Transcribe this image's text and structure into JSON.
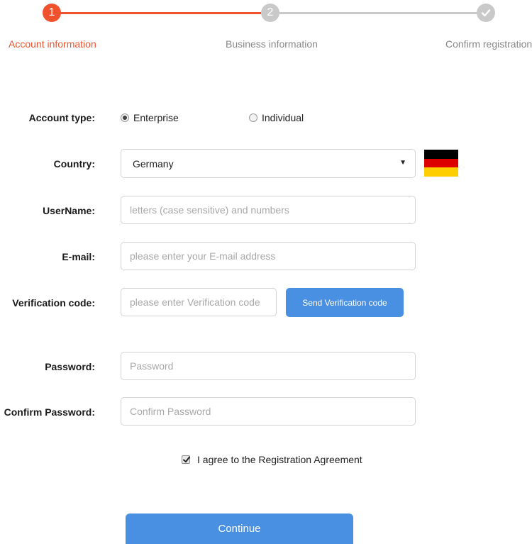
{
  "colors": {
    "active": "#f0522e",
    "inactive": "#c9c9c9",
    "primary": "#4a90e2"
  },
  "stepper": {
    "steps": [
      {
        "number": "1",
        "label": "Account information",
        "state": "active"
      },
      {
        "number": "2",
        "label": "Business information",
        "state": "inactive"
      },
      {
        "number": "",
        "label": "Confirm registration",
        "state": "inactive",
        "icon": "checkmark-icon"
      }
    ]
  },
  "form": {
    "account_type": {
      "label": "Account type:",
      "options": [
        {
          "label": "Enterprise",
          "selected": true
        },
        {
          "label": "Individual",
          "selected": false
        }
      ]
    },
    "country": {
      "label": "Country:",
      "value": "Germany",
      "flag_colors": [
        "#000000",
        "#dd0000",
        "#ffce00"
      ]
    },
    "username": {
      "label": "UserName:",
      "placeholder": "letters (case sensitive) and numbers"
    },
    "email": {
      "label": "E-mail:",
      "placeholder": "please enter your E-mail address"
    },
    "verification": {
      "label": "Verification code:",
      "placeholder": "please enter Verification code",
      "button_label": "Send Verification code"
    },
    "password": {
      "label": "Password:",
      "placeholder": "Password"
    },
    "confirm_password": {
      "label": "Confirm Password:",
      "placeholder": "Confirm Password"
    },
    "agreement": {
      "label": "I agree to the Registration Agreement",
      "checked": true
    },
    "continue_label": "Continue"
  }
}
